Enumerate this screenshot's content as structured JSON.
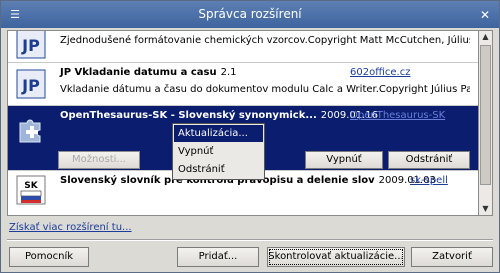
{
  "window": {
    "title": "Správca rozšírení"
  },
  "extensions": [
    {
      "name": "",
      "version": "",
      "link": "",
      "description": "Zjednodušené formátovanie chemických vzorcov.Copyright Matt McCutchen, Július Pastierik (c"
    },
    {
      "name": "JP Vkladanie datumu a casu",
      "version": "2.1",
      "link": "602office.cz",
      "description": "Vkladanie dátumu a času do dokumentov modulu Calc a Writer.Copyright Július Pastierik (c) ..."
    },
    {
      "name": "OpenThesaurus-SK - Slovenský synonymick...",
      "version": "2009.01.16",
      "link": "OpenThesaurus-SK",
      "description": ""
    },
    {
      "name": "Slovenský slovník pre kontrolu pravopisu a delenie slov",
      "version": "2009.01.03",
      "link": "sk-spell",
      "description": ""
    }
  ],
  "selected_buttons": {
    "options": "Možnosti...",
    "disable": "Vypnúť",
    "remove": "Odstrániť"
  },
  "context_menu": [
    "Aktualizácia...",
    "Vypnúť",
    "Odstrániť"
  ],
  "more_link": "Získať viac rozšírení tu...",
  "footer": {
    "help": "Pomocník",
    "add": "Pridať...",
    "check_updates": "Skontrolovať aktualizácie...",
    "close": "Zatvoriť"
  },
  "colors": {
    "selection": "#0a1d6e",
    "titlebar": "#4d72aa",
    "link": "#1b3c9a"
  }
}
